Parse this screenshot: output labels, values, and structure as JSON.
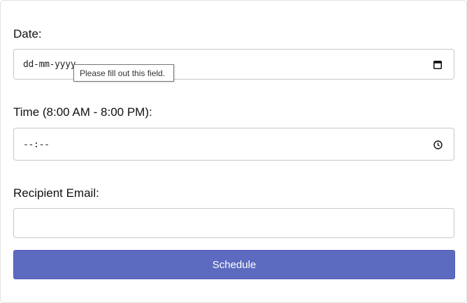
{
  "form": {
    "date": {
      "label": "Date:",
      "value": "dd-mm-yyyy",
      "icon": "calendar-icon"
    },
    "tooltip": "Please fill out this field.",
    "time": {
      "label": "Time (8:00 AM - 8:00 PM):",
      "value": "--:--",
      "icon": "clock-icon"
    },
    "email": {
      "label": "Recipient Email:",
      "value": ""
    },
    "submit_label": "Schedule"
  },
  "colors": {
    "accent": "#5c6bc0",
    "border": "#c8c8c8"
  }
}
